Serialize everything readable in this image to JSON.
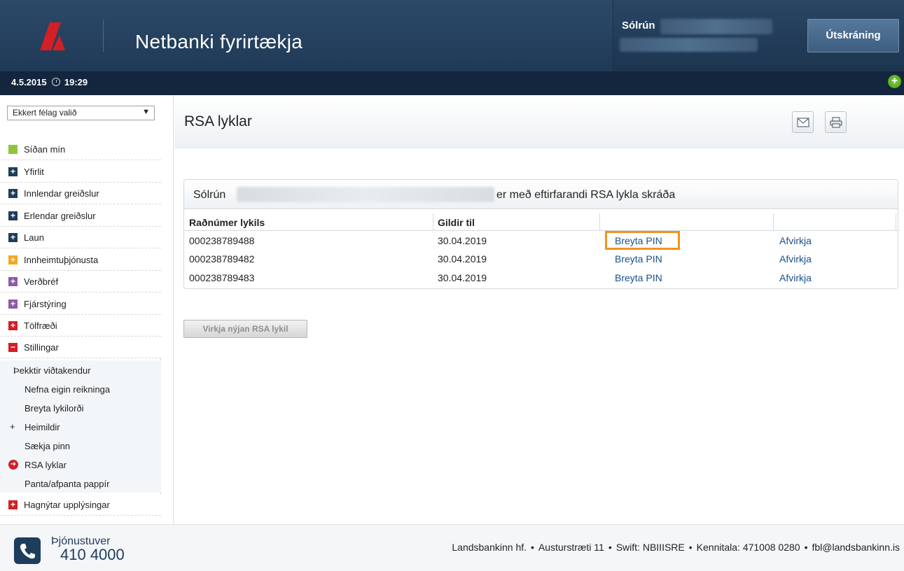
{
  "header": {
    "app_title": "Netbanki fyrirtækja",
    "user_name": "Sólrún",
    "logout_label": "Útskráning",
    "date": "4.5.2015",
    "time": "19:29"
  },
  "sidebar": {
    "company_select": "Ekkert félag valið",
    "items": [
      {
        "label": "Síðan mín",
        "icon": "square-icon",
        "color": "#8cc63f"
      },
      {
        "label": "Yfirlit",
        "icon": "plus-icon",
        "color": "#1e3c5c"
      },
      {
        "label": "Innlendar greiðslur",
        "icon": "plus-icon",
        "color": "#1e3c5c"
      },
      {
        "label": "Erlendar greiðslur",
        "icon": "plus-icon",
        "color": "#1e3c5c"
      },
      {
        "label": "Laun",
        "icon": "plus-icon",
        "color": "#1e3c5c"
      },
      {
        "label": "Innheimtuþjónusta",
        "icon": "plus-icon",
        "color": "#f5a623"
      },
      {
        "label": "Verðbréf",
        "icon": "plus-icon",
        "color": "#8e5aa6"
      },
      {
        "label": "Fjárstýring",
        "icon": "plus-icon",
        "color": "#8e5aa6"
      },
      {
        "label": "Tölfræði",
        "icon": "plus-icon",
        "color": "#d31f26"
      },
      {
        "label": "Stillingar",
        "icon": "minus-icon",
        "color": "#d31f26"
      }
    ],
    "sub_items": [
      {
        "label": "Þekktir viðtakendur"
      },
      {
        "label": "Nefna eigin reikninga"
      },
      {
        "label": "Breyta lykilorði"
      },
      {
        "label": "Heimildir",
        "icon": "plus-icon"
      },
      {
        "label": "Sækja pinn"
      },
      {
        "label": "RSA lyklar",
        "icon": "active-arrow-icon"
      },
      {
        "label": "Panta/afpanta pappír"
      }
    ],
    "bottom_item": {
      "label": "Hagnýtar upplýsingar",
      "icon": "plus-icon",
      "color": "#d31f26"
    }
  },
  "main": {
    "title": "RSA lyklar",
    "panel": {
      "owner": "Sólrún",
      "suffix": "er með eftirfarandi RSA lykla skráða",
      "columns": [
        "Raðnúmer lykils",
        "Gildir til"
      ],
      "rows": [
        {
          "serial": "000238789488",
          "valid_until": "30.04.2019",
          "change_pin": "Breyta PIN",
          "deactivate": "Afvirkja"
        },
        {
          "serial": "000238789482",
          "valid_until": "30.04.2019",
          "change_pin": "Breyta PIN",
          "deactivate": "Afvirkja"
        },
        {
          "serial": "000238789483",
          "valid_until": "30.04.2019",
          "change_pin": "Breyta PIN",
          "deactivate": "Afvirkja"
        }
      ]
    },
    "activate_button": "Virkja nýjan RSA lykil"
  },
  "footer": {
    "phone_label": "Þjónustuver",
    "phone_number": "410 4000",
    "company": "Landsbankinn hf.",
    "address": "Austurstræti 11",
    "swift": "Swift: NBIIISRE",
    "kennitala": "Kennitala: 471008 0280",
    "email": "fbl@landsbankinn.is"
  },
  "colors": {
    "header_bg": "#1f3a57",
    "brand_red": "#d31f26",
    "link": "#1a4f8a",
    "highlight": "#f39322"
  }
}
